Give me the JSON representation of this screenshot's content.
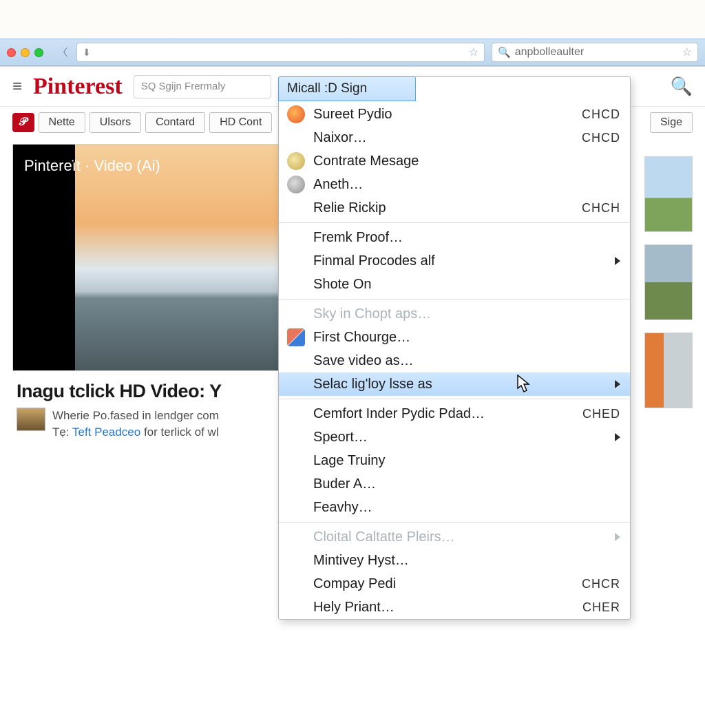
{
  "browser": {
    "url_value": "",
    "search_value": "anpbolleaulter"
  },
  "site": {
    "brand": "Pinterest",
    "header_search_placeholder": "SQ Sgijn Frermaly"
  },
  "nav": {
    "items": [
      "Nette",
      "Ulsors",
      "Contard",
      "HD Cont",
      "Sige"
    ]
  },
  "video": {
    "overlay_title": "Pintereït · Video (Ai)"
  },
  "article": {
    "title": "Inagu tclick HD Video: Y",
    "body_line1": "Wherie Po.fased in lendger com",
    "body_prefix": "Tẹ: ",
    "body_highlight": "Teft Peadceo",
    "body_suffix": " for terlick of wl"
  },
  "context_menu": {
    "header": "Micall :D Sign",
    "items": [
      {
        "label": "Sureet Pydio",
        "icon": "fox",
        "shortcut": "CHCD"
      },
      {
        "label": "Naixor…",
        "shortcut": "CHCD"
      },
      {
        "label": "Contrate Mesage",
        "icon": "globe"
      },
      {
        "label": "Aneth…",
        "icon": "grey"
      },
      {
        "label": "Relie Rickip",
        "shortcut": "CHCH"
      },
      {
        "sep": true
      },
      {
        "label": "Fremk Proof…"
      },
      {
        "label": "Finmal Procodes alf",
        "submenu": true
      },
      {
        "label": "Shote On"
      },
      {
        "sep": true
      },
      {
        "label": "Sky in Chopt aps…",
        "disabled": true
      },
      {
        "label": "First Chourge…",
        "icon": "pencil"
      },
      {
        "label": "Save video as…"
      },
      {
        "label": "Selac lig'loy lsse as",
        "submenu": true,
        "hovered": true
      },
      {
        "sep": true
      },
      {
        "label": "Cemfort Inder Pydic Pdad…",
        "shortcut": "CHED"
      },
      {
        "label": "Speort…",
        "submenu": true
      },
      {
        "label": "Lage Truiny"
      },
      {
        "label": "Buder A…"
      },
      {
        "label": "Feavhy…"
      },
      {
        "sep": true
      },
      {
        "label": "Cloital Caltatte Pleirs…",
        "disabled": true,
        "submenu": true
      },
      {
        "label": "Mintivey Hyst…"
      },
      {
        "label": "Compay Pedi",
        "shortcut": "CHCR"
      },
      {
        "label": "Hely Priant…",
        "shortcut": "CHER"
      }
    ]
  }
}
